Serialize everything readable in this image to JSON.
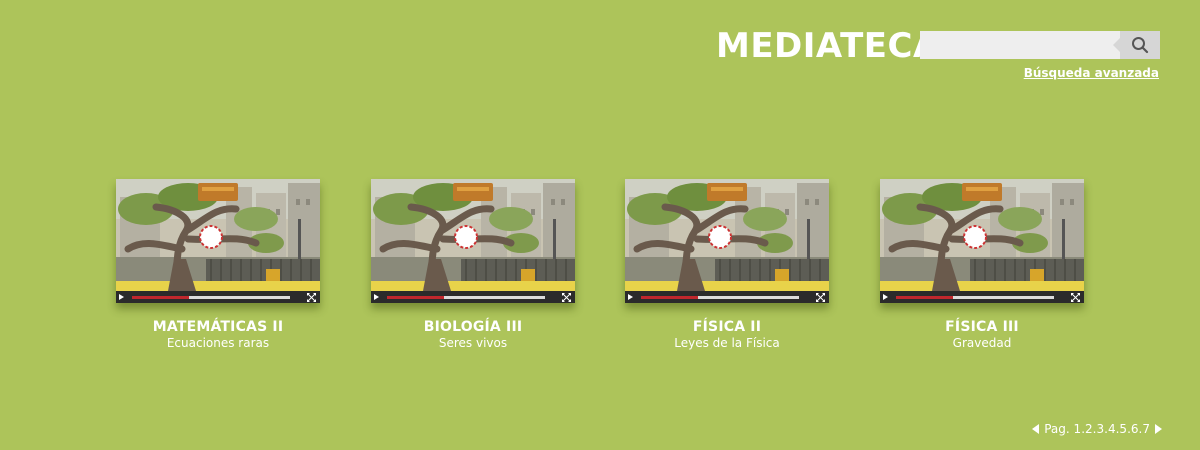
{
  "header": {
    "title": "MEDIATECA",
    "search_placeholder": "",
    "search_icon": "search-icon",
    "advanced_search": "Búsqueda avanzada"
  },
  "videos": [
    {
      "title": "MATEMÁTICAS II",
      "subtitle": "Ecuaciones raras",
      "progress": 0.36
    },
    {
      "title": "BIOLOGÍA III",
      "subtitle": "Seres vivos",
      "progress": 0.36
    },
    {
      "title": "FÍSICA II",
      "subtitle": "Leyes de la Física",
      "progress": 0.36
    },
    {
      "title": "FÍSICA III",
      "subtitle": "Gravedad",
      "progress": 0.36
    }
  ],
  "pagination": {
    "label": "Pag.",
    "pages": [
      "1",
      "2",
      "3",
      "4",
      "5",
      "6",
      "7"
    ]
  },
  "colors": {
    "background": "#adc45a",
    "progress": "#c0272d"
  }
}
